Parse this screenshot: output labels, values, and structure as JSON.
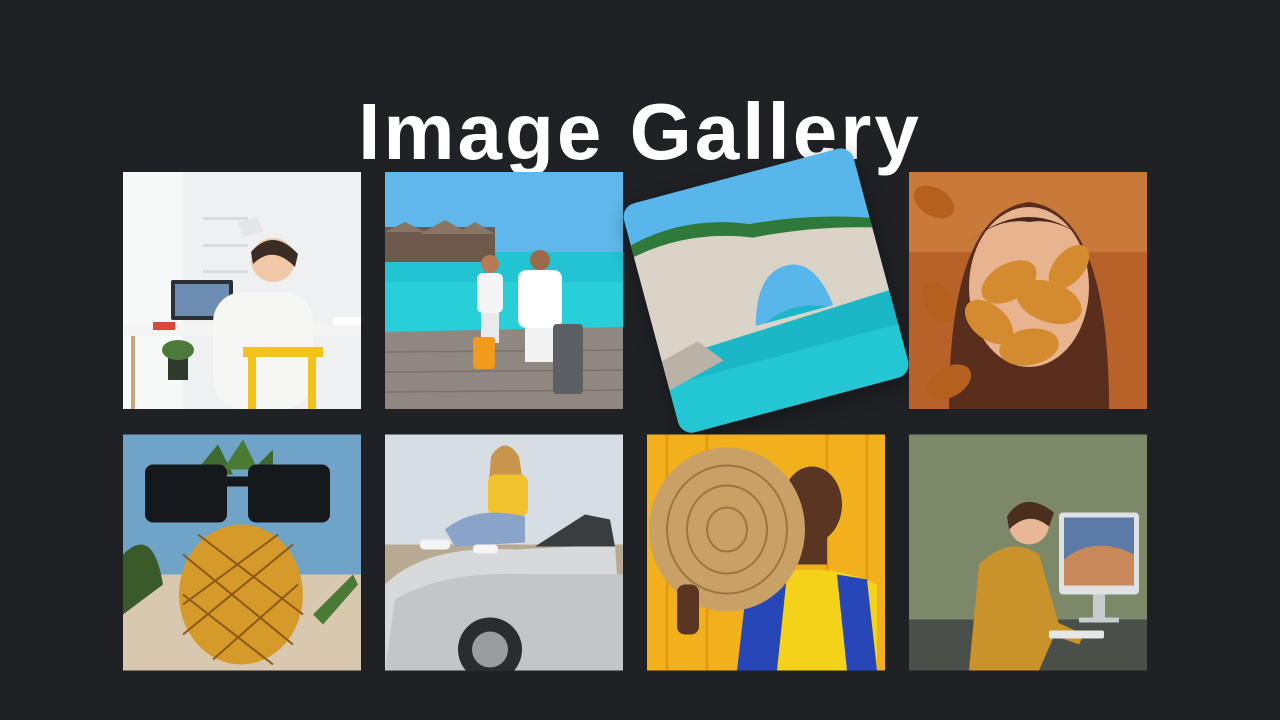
{
  "page": {
    "title": "Image Gallery",
    "background": "#202125"
  },
  "gallery": {
    "items": [
      {
        "id": "workspace-laptop",
        "state": "normal"
      },
      {
        "id": "beach-couple-luggage",
        "state": "normal"
      },
      {
        "id": "sea-cliff-arch",
        "state": "hovered-rotated"
      },
      {
        "id": "woman-autumn-leaves",
        "state": "normal"
      },
      {
        "id": "pineapple-sunglasses",
        "state": "normal"
      },
      {
        "id": "woman-on-convertible",
        "state": "normal"
      },
      {
        "id": "woman-straw-hat",
        "state": "normal"
      },
      {
        "id": "man-drawing-desk",
        "state": "normal"
      }
    ]
  }
}
